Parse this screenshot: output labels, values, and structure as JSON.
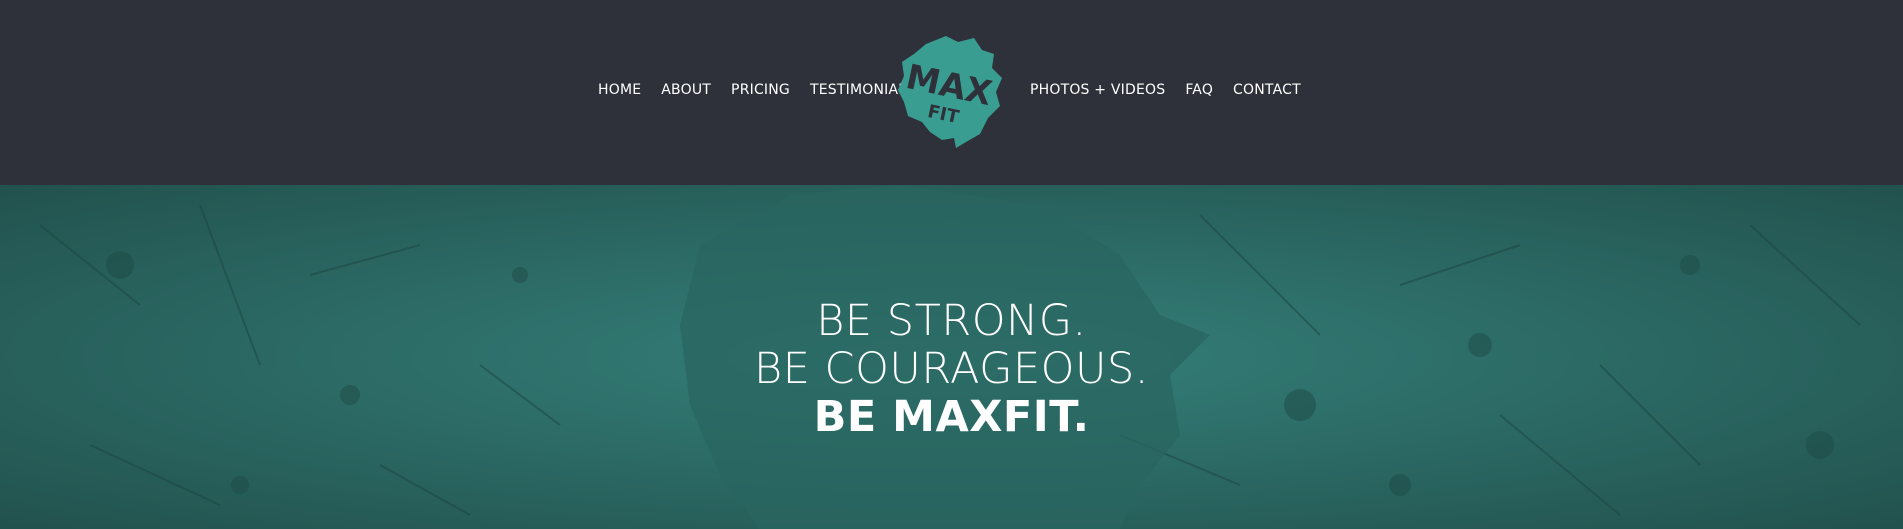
{
  "nav": {
    "left": [
      {
        "label": "HOME"
      },
      {
        "label": "ABOUT"
      },
      {
        "label": "PRICING"
      },
      {
        "label": "TESTIMONIALS"
      }
    ],
    "right": [
      {
        "label": "PHOTOS + VIDEOS"
      },
      {
        "label": "FAQ"
      },
      {
        "label": "CONTACT"
      }
    ]
  },
  "logo": {
    "line1": "MAX",
    "line2": "FIT",
    "icon": "lion-head-logo",
    "color": "#3a9d92"
  },
  "hero": {
    "line1": "BE STRONG.",
    "line2": "BE COURAGEOUS.",
    "line3": "BE MAXFIT.",
    "background_color": "#2d6e67"
  },
  "colors": {
    "header_bg": "#2e3139",
    "text": "#ffffff",
    "accent": "#3a9d92"
  }
}
